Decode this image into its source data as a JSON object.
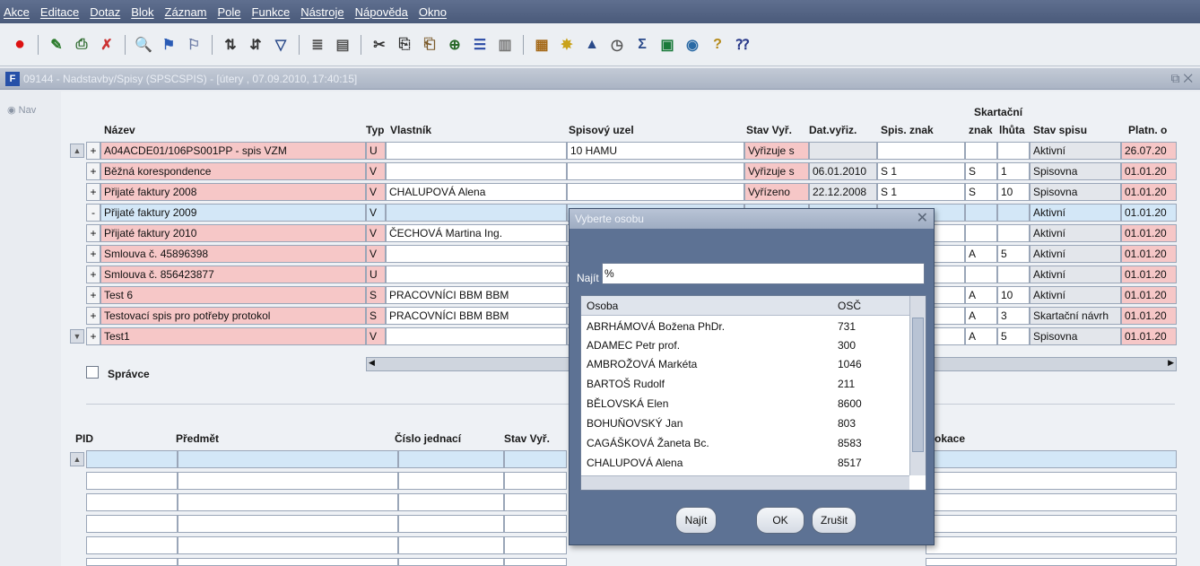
{
  "menu": [
    "Akce",
    "Editace",
    "Dotaz",
    "Blok",
    "Záznam",
    "Pole",
    "Funkce",
    "Nástroje",
    "Nápověda",
    "Okno"
  ],
  "window": {
    "title": "09144 - Nadstavby/Spisy (SPSCSPIS) - [útery , 07.09.2010, 17:40:15]",
    "nav": "Nav"
  },
  "grid": {
    "headers": {
      "nazev": "Název",
      "typ": "Typ",
      "vlastnik": "Vlastník",
      "uzel": "Spisový uzel",
      "stav": "Stav Vyř.",
      "dat": "Dat.vyřiz.",
      "znak": "Spis. znak",
      "skart_top": "Skartační",
      "skart_znak": "znak",
      "lhuta": "lhůta",
      "stavspisu": "Stav spisu",
      "platn": "Platn. o"
    },
    "rows": [
      {
        "exp": "+",
        "nazev": "A04ACDE01/106PS001PP - spis VZM",
        "typ": "U",
        "vlastnik": "",
        "uzel": "10 HAMU",
        "stav": "Vyřizuje s",
        "dat": "",
        "znak": "",
        "sz": "",
        "lh": "",
        "stavspisu": "Aktivní",
        "platn": "26.07.20"
      },
      {
        "exp": "+",
        "nazev": "Běžná korespondence",
        "typ": "V",
        "vlastnik": "",
        "uzel": "",
        "stav": "Vyřizuje s",
        "dat": "06.01.2010",
        "znak": "S 1",
        "sz": "S",
        "lh": "1",
        "stavspisu": "Spisovna",
        "platn": "01.01.20"
      },
      {
        "exp": "+",
        "nazev": "Přijaté faktury 2008",
        "typ": "V",
        "vlastnik": "CHALUPOVÁ Alena",
        "uzel": "",
        "stav": "Vyřízeno",
        "dat": "22.12.2008",
        "znak": "S 1",
        "sz": "S",
        "lh": "10",
        "stavspisu": "Spisovna",
        "platn": "01.01.20"
      },
      {
        "exp": "-",
        "nazev": "Přijaté faktury 2009",
        "typ": "V",
        "vlastnik": "",
        "uzel": "",
        "stav": "",
        "dat": "",
        "znak": "",
        "sz": "",
        "lh": "",
        "stavspisu": "Aktivní",
        "platn": "01.01.20"
      },
      {
        "exp": "+",
        "nazev": "Přijaté faktury 2010",
        "typ": "V",
        "vlastnik": "ČECHOVÁ Martina Ing.",
        "uzel": "",
        "stav": "",
        "dat": "",
        "znak": "",
        "sz": "",
        "lh": "",
        "stavspisu": "Aktivní",
        "platn": "01.01.20"
      },
      {
        "exp": "+",
        "nazev": "Smlouva č. 45896398",
        "typ": "V",
        "vlastnik": "",
        "uzel": "",
        "stav": "",
        "dat": "",
        "znak": "",
        "sz": "A",
        "lh": "5",
        "stavspisu": "Aktivní",
        "platn": "01.01.20"
      },
      {
        "exp": "+",
        "nazev": "Smlouva č. 856423877",
        "typ": "U",
        "vlastnik": "",
        "uzel": "",
        "stav": "",
        "dat": "",
        "znak": "",
        "sz": "",
        "lh": "",
        "stavspisu": "Aktivní",
        "platn": "01.01.20"
      },
      {
        "exp": "+",
        "nazev": "Test 6",
        "typ": "S",
        "vlastnik": "PRACOVNÍCI BBM BBM",
        "uzel": "",
        "stav": "",
        "dat": "",
        "znak": "",
        "sz": "A",
        "lh": "10",
        "stavspisu": "Aktivní",
        "platn": "01.01.20"
      },
      {
        "exp": "+",
        "nazev": "Testovací spis pro potřeby protokol",
        "typ": "S",
        "vlastnik": "PRACOVNÍCI BBM BBM",
        "uzel": "",
        "stav": "",
        "dat": "",
        "znak": "",
        "sz": "A",
        "lh": "3",
        "stavspisu": "Skartační návrh",
        "platn": "01.01.20"
      },
      {
        "exp": "+",
        "nazev": "Test1",
        "typ": "V",
        "vlastnik": "",
        "uzel": "",
        "stav": "",
        "dat": "",
        "znak": "",
        "sz": "A",
        "lh": "5",
        "stavspisu": "Spisovna",
        "platn": "01.01.20"
      }
    ]
  },
  "spravce": {
    "label": "Správce"
  },
  "lower": {
    "headers": {
      "pid": "PID",
      "predmet": "Předmět",
      "cislo": "Číslo jednací",
      "stav": "Stav Vyř.",
      "lokace": "okace"
    }
  },
  "dialog": {
    "title": "Vyberte osobu",
    "find_label": "Najít",
    "find_value": "%",
    "col_osoba": "Osoba",
    "col_osc": "OSČ",
    "rows": [
      {
        "name": "ABRHÁMOVÁ Božena PhDr.",
        "osc": "731"
      },
      {
        "name": "ADAMEC Petr prof.",
        "osc": "300"
      },
      {
        "name": "AMBROŽOVÁ Markéta",
        "osc": "1046"
      },
      {
        "name": "BARTOŠ Rudolf",
        "osc": "211"
      },
      {
        "name": "BĚLOVSKÁ Elen",
        "osc": "8600"
      },
      {
        "name": "BOHUŇOVSKÝ Jan",
        "osc": "803"
      },
      {
        "name": "CAGÁŠKOVÁ Žaneta Bc.",
        "osc": "8583"
      },
      {
        "name": "CHALUPOVÁ Alena",
        "osc": "8517"
      }
    ],
    "btn_find": "Najít",
    "btn_ok": "OK",
    "btn_cancel": "Zrušit"
  }
}
